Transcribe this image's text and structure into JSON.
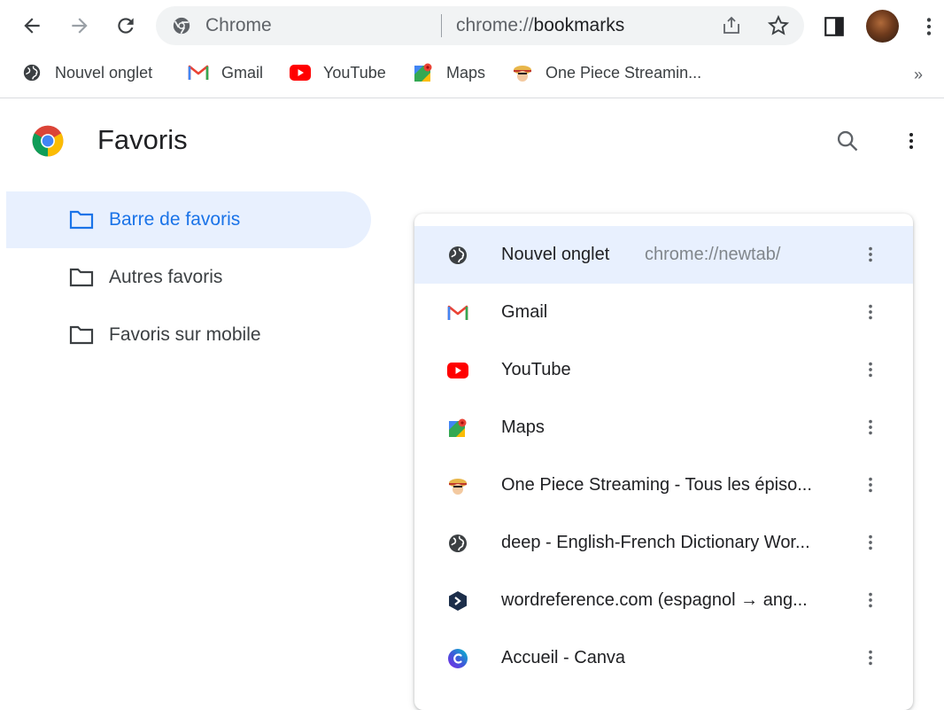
{
  "toolbar": {
    "omnibox": {
      "chip": "Chrome",
      "url_scheme": "chrome://",
      "url_host": "bookmarks"
    }
  },
  "bookmarks_bar": {
    "items": [
      {
        "label": "Nouvel onglet",
        "icon": "globe-icon"
      },
      {
        "label": "Gmail",
        "icon": "gmail-icon"
      },
      {
        "label": "YouTube",
        "icon": "youtube-icon"
      },
      {
        "label": "Maps",
        "icon": "maps-icon"
      },
      {
        "label": "One Piece Streamin...",
        "icon": "one-piece-icon"
      }
    ],
    "overflow": "»"
  },
  "page": {
    "title": "Favoris"
  },
  "sidebar": {
    "items": [
      {
        "label": "Barre de favoris",
        "active": true
      },
      {
        "label": "Autres favoris",
        "active": false
      },
      {
        "label": "Favoris sur mobile",
        "active": false
      }
    ]
  },
  "list": {
    "rows": [
      {
        "title": "Nouvel onglet",
        "url": "chrome://newtab/",
        "icon": "globe-icon"
      },
      {
        "title": "Gmail",
        "url": "",
        "icon": "gmail-icon"
      },
      {
        "title": "YouTube",
        "url": "",
        "icon": "youtube-icon"
      },
      {
        "title": "Maps",
        "url": "",
        "icon": "maps-icon"
      },
      {
        "title": "One Piece Streaming - Tous les épiso...",
        "url": "",
        "icon": "one-piece-icon"
      },
      {
        "title": "deep - English-French Dictionary Wor...",
        "url": "",
        "icon": "globe-icon"
      },
      {
        "title": "wordreference.com (espagnol → ang...",
        "url": "",
        "icon": "wordreference-icon"
      },
      {
        "title": "Accueil - Canva",
        "url": "",
        "icon": "canva-icon"
      }
    ]
  },
  "colors": {
    "accent": "#1a73e8",
    "selected_bg": "#e8f0fe",
    "youtube_red": "#ff0000",
    "gmail_red": "#ea4335"
  }
}
